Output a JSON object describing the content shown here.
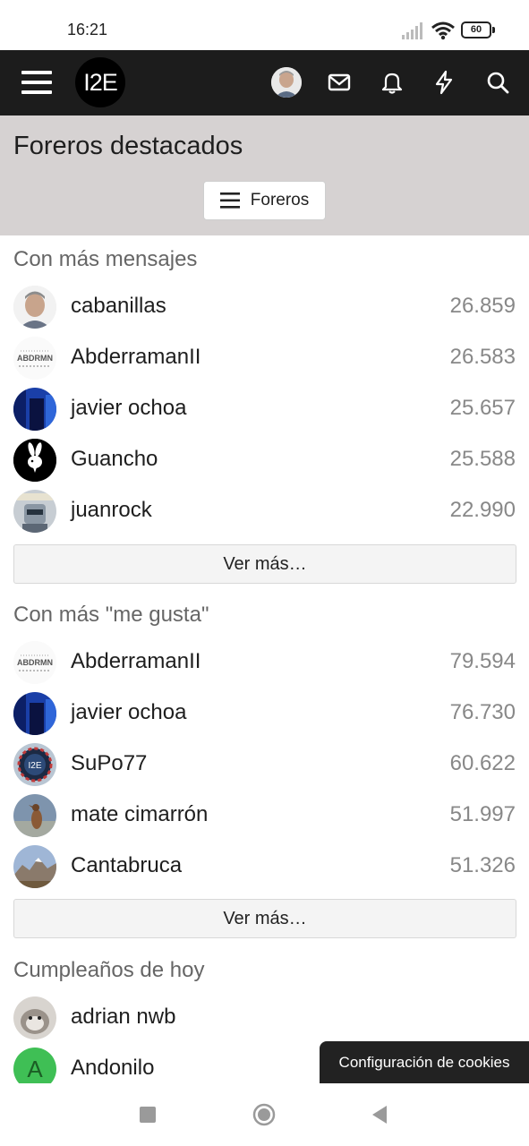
{
  "status_bar": {
    "time": "16:21",
    "battery": "60",
    "icons": [
      "signal-icon",
      "wifi-icon",
      "battery-icon"
    ]
  },
  "nav": {
    "logo_text": "I2E",
    "icons": [
      "hamburger-menu-icon",
      "user-avatar",
      "mail-icon",
      "bell-icon",
      "bolt-icon",
      "search-icon"
    ]
  },
  "header": {
    "title": "Foreros destacados",
    "foreros_button": "Foreros"
  },
  "sections": {
    "mensajes": {
      "title": "Con más mensajes",
      "rows": [
        {
          "name": "cabanillas",
          "value": "26.859"
        },
        {
          "name": "AbderramanII",
          "value": "26.583"
        },
        {
          "name": "javier ochoa",
          "value": "25.657"
        },
        {
          "name": "Guancho",
          "value": "25.588"
        },
        {
          "name": "juanrock",
          "value": "22.990"
        }
      ],
      "more": "Ver más…"
    },
    "megusta": {
      "title": "Con más \"me gusta\"",
      "rows": [
        {
          "name": "AbderramanII",
          "value": "79.594"
        },
        {
          "name": "javier ochoa",
          "value": "76.730"
        },
        {
          "name": "SuPo77",
          "value": "60.622"
        },
        {
          "name": "mate cimarrón",
          "value": "51.997"
        },
        {
          "name": "Cantabruca",
          "value": "51.326"
        }
      ],
      "more": "Ver más…"
    },
    "cumple": {
      "title": "Cumpleaños de hoy",
      "rows": [
        {
          "name": "adrian nwb"
        },
        {
          "name": "Andonilo",
          "initial": "A"
        }
      ]
    }
  },
  "cookie_button": "Configuración de cookies",
  "colors": {
    "navbar": "#1c1c1c",
    "header_band": "#d6d2d2",
    "avatar_green": "#3fbf55"
  }
}
